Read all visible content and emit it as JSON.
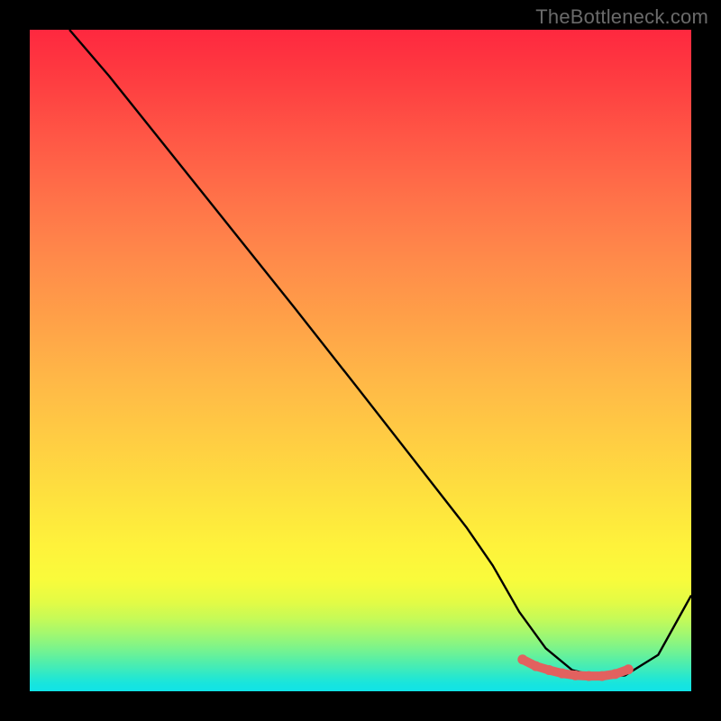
{
  "attribution": "TheBottleneck.com",
  "chart_data": {
    "type": "line",
    "title": "",
    "xlabel": "",
    "ylabel": "",
    "xlim": [
      0,
      100
    ],
    "ylim": [
      0,
      100
    ],
    "series": [
      {
        "name": "curve",
        "x": [
          6,
          12,
          20,
          30,
          40,
          50,
          60,
          66,
          70,
          74,
          78,
          82,
          86,
          90,
          95,
          100
        ],
        "values": [
          100,
          93,
          83,
          70.5,
          58,
          45.3,
          32.5,
          24.8,
          19,
          12,
          6.5,
          3.2,
          2.2,
          2.4,
          5.5,
          14.5
        ]
      }
    ],
    "markers": {
      "name": "highlighted-segment",
      "x": [
        74.5,
        76.5,
        78.5,
        80.5,
        82.5,
        84.5,
        86.5,
        88.5,
        90.5
      ],
      "values": [
        4.8,
        3.8,
        3.2,
        2.7,
        2.4,
        2.3,
        2.3,
        2.6,
        3.3
      ]
    },
    "colors": {
      "curve": "#000000",
      "markers": "#e2615f"
    }
  }
}
